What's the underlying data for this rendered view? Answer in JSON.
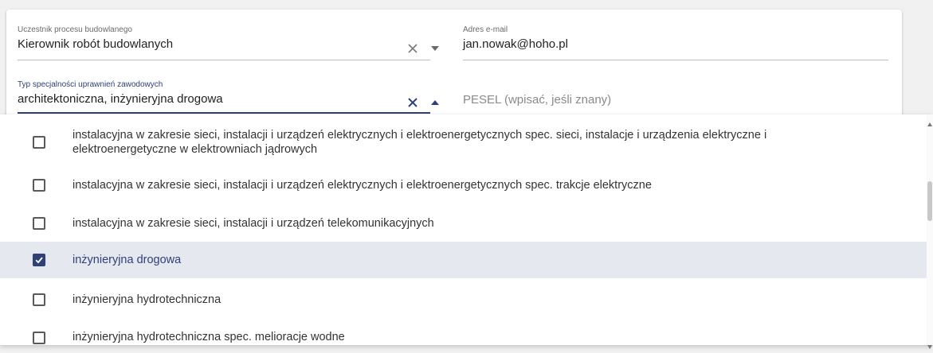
{
  "form": {
    "participant": {
      "label": "Uczestnik procesu budowlanego",
      "value": "Kierownik robót budowlanych"
    },
    "email": {
      "label": "Adres e-mail",
      "value": "jan.nowak@hoho.pl"
    },
    "specialty": {
      "label": "Typ specjalności uprawnień zawodowych",
      "value": "architektoniczna, inżynieryjna drogowa"
    },
    "pesel": {
      "placeholder": "PESEL (wpisać, jeśli znany)"
    }
  },
  "dropdown": {
    "options": [
      {
        "line1": "instalacyjna w zakresie sieci, instalacji i urządzeń elektrycznych i elektroenergetycznych spec. sieci, instalacje i urządzenia elektryczne i",
        "line2": "elektroenergetyczne w elektrowniach jądrowych",
        "checked": false
      },
      {
        "line1": "instalacyjna w zakresie sieci, instalacji i urządzeń elektrycznych i elektroenergetycznych spec. trakcje elektryczne",
        "checked": false
      },
      {
        "line1": "instalacyjna w zakresie sieci, instalacji i urządzeń telekomunikacyjnych",
        "checked": false
      },
      {
        "line1": "inżynieryjna drogowa",
        "checked": true
      },
      {
        "line1": "inżynieryjna hydrotechniczna",
        "checked": false
      },
      {
        "line1": "inżynieryjna hydrotechniczna spec. melioracje wodne",
        "checked": false
      }
    ]
  },
  "icons": {
    "clear": "close-icon",
    "dropdown_closed": "caret-down-icon",
    "dropdown_open": "caret-up-icon",
    "checked": "check-icon"
  },
  "colors": {
    "accent": "#2f3f7a",
    "selected_row_bg": "#e6e8ef"
  }
}
